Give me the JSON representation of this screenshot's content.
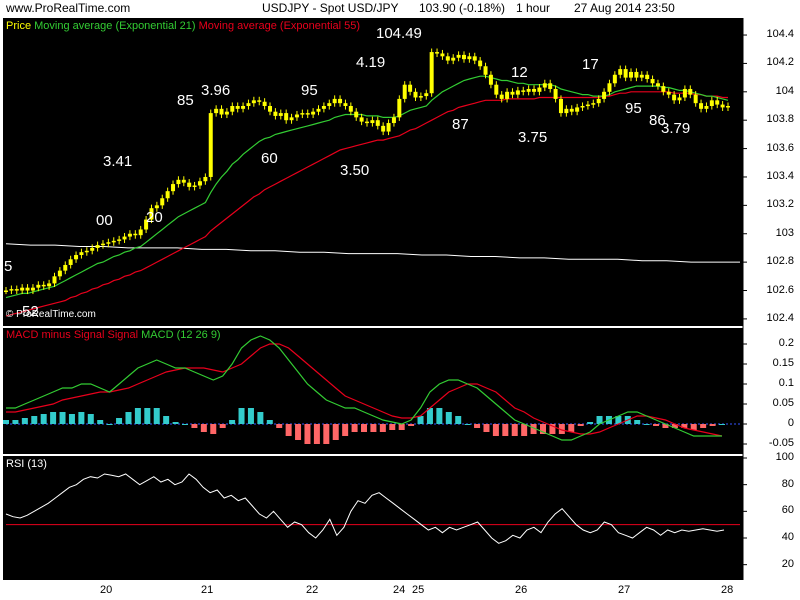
{
  "header": {
    "site": "www.ProRealTime.com",
    "instrument": "USDJPY - Spot USD/JPY",
    "quote": "103.90 (-0.18%)",
    "timeframe": "1 hour",
    "datetime": "27 Aug 2014 23:50"
  },
  "watermark": "© ProRealTime.com",
  "colors": {
    "background": "#000000",
    "candle": "#ffff00",
    "ema21": "#33cc33",
    "ema55": "#e8001c",
    "ma_long": "#ffffff",
    "macd_line": "#33cc33",
    "signal_line": "#e8001c",
    "histogram_pos": "#33cccc",
    "histogram_neg": "#ff6666",
    "rsi_line": "#ffffff",
    "rsi_level": "#e8001c"
  },
  "panels": {
    "price": {
      "legend": [
        {
          "text": "Price",
          "color": "#ffff00"
        },
        {
          "text": "Moving average (Exponential 21)",
          "color": "#33cc33"
        },
        {
          "text": "Moving average (Exponential 55)",
          "color": "#e8001c"
        }
      ],
      "ticks": [
        "104.4",
        "104.2",
        "104",
        "103.8",
        "103.6",
        "103.4",
        "103.2",
        "103",
        "102.8",
        "102.6",
        "102.4"
      ]
    },
    "macd": {
      "legend": [
        {
          "text": "MACD minus Signal",
          "color": "#e8001c"
        },
        {
          "text": "Signal",
          "color": "#e8001c"
        },
        {
          "text": "MACD (12 26 9)",
          "color": "#33cc33"
        }
      ],
      "ticks": [
        "0.2",
        "0.15",
        "0.1",
        "0.05",
        "0",
        "-0.05"
      ]
    },
    "rsi": {
      "legend": [
        {
          "text": "RSI (13)",
          "color": "#ffffff"
        }
      ],
      "ticks": [
        "100",
        "80",
        "60",
        "40",
        "20"
      ]
    }
  },
  "x_ticks": [
    "20",
    "21",
    "22",
    "24",
    "25",
    "26",
    "27",
    "28"
  ],
  "annotations": [
    "5",
    "52",
    "00",
    "20",
    "3.41",
    "85",
    "3.96",
    "60",
    "95",
    "4.19",
    "3.50",
    "104.49",
    "87",
    "12",
    "3.75",
    "17",
    "95",
    "86",
    "3.79"
  ],
  "chart_data": {
    "type": "candlestick",
    "title": "USDJPY - Spot USD/JPY",
    "x_ticks": [
      "20",
      "21",
      "22",
      "24",
      "25",
      "26",
      "27",
      "28"
    ],
    "price_range": [
      102.35,
      104.52
    ],
    "ema21_range_note": "",
    "close": [
      102.6,
      102.61,
      102.6,
      102.62,
      102.6,
      102.62,
      102.64,
      102.63,
      102.65,
      102.7,
      102.74,
      102.78,
      102.82,
      102.85,
      102.87,
      102.88,
      102.9,
      102.92,
      102.93,
      102.94,
      102.95,
      102.96,
      102.98,
      103.0,
      102.99,
      103.03,
      103.1,
      103.18,
      103.2,
      103.25,
      103.3,
      103.35,
      103.38,
      103.36,
      103.33,
      103.34,
      103.37,
      103.4,
      103.85,
      103.88,
      103.84,
      103.86,
      103.9,
      103.88,
      103.9,
      103.92,
      103.94,
      103.93,
      103.9,
      103.86,
      103.83,
      103.85,
      103.8,
      103.82,
      103.84,
      103.85,
      103.84,
      103.86,
      103.88,
      103.9,
      103.92,
      103.95,
      103.92,
      103.9,
      103.86,
      103.82,
      103.79,
      103.78,
      103.8,
      103.76,
      103.72,
      103.78,
      103.82,
      103.95,
      104.05,
      104.0,
      103.96,
      103.97,
      103.99,
      104.28,
      104.27,
      104.25,
      104.22,
      104.24,
      104.26,
      104.23,
      104.25,
      104.22,
      104.18,
      104.12,
      104.05,
      103.98,
      103.95,
      104.0,
      103.98,
      104.01,
      104.0,
      104.02,
      104.0,
      104.03,
      104.06,
      104.02,
      103.95,
      103.85,
      103.88,
      103.86,
      103.89,
      103.9,
      103.91,
      103.92,
      103.95,
      104.0,
      104.06,
      104.12,
      104.16,
      104.1,
      104.14,
      104.1,
      104.12,
      104.09,
      104.06,
      104.04,
      104.0,
      103.98,
      103.94,
      103.96,
      104.02,
      103.98,
      103.92,
      103.88,
      103.9,
      103.94,
      103.91,
      103.89,
      103.9
    ],
    "series": [
      {
        "name": "Moving average (Exponential 21)",
        "values": [
          102.55,
          102.56,
          102.57,
          102.58,
          102.58,
          102.59,
          102.6,
          102.61,
          102.62,
          102.63,
          102.65,
          102.67,
          102.69,
          102.71,
          102.73,
          102.75,
          102.77,
          102.79,
          102.8,
          102.82,
          102.84,
          102.85,
          102.87,
          102.88,
          102.9,
          102.91,
          102.94,
          102.97,
          103.0,
          103.03,
          103.06,
          103.09,
          103.12,
          103.14,
          103.16,
          103.18,
          103.2,
          103.22,
          103.29,
          103.35,
          103.4,
          103.44,
          103.49,
          103.52,
          103.56,
          103.59,
          103.62,
          103.65,
          103.67,
          103.68,
          103.7,
          103.71,
          103.72,
          103.73,
          103.74,
          103.75,
          103.76,
          103.77,
          103.78,
          103.79,
          103.8,
          103.82,
          103.83,
          103.84,
          103.84,
          103.84,
          103.84,
          103.83,
          103.83,
          103.83,
          103.82,
          103.82,
          103.82,
          103.83,
          103.85,
          103.87,
          103.88,
          103.89,
          103.9,
          103.94,
          103.97,
          104.0,
          104.02,
          104.04,
          104.06,
          104.08,
          104.09,
          104.1,
          104.11,
          104.11,
          104.1,
          104.09,
          104.08,
          104.08,
          104.07,
          104.06,
          104.06,
          104.05,
          104.05,
          104.05,
          104.05,
          104.05,
          104.04,
          104.02,
          104.01,
          104.0,
          103.99,
          103.98,
          103.98,
          103.97,
          103.97,
          103.97,
          103.98,
          104.0,
          104.01,
          104.02,
          104.03,
          104.04,
          104.04,
          104.04,
          104.04,
          104.04,
          104.03,
          104.03,
          104.02,
          104.01,
          104.01,
          104.0,
          103.99,
          103.98,
          103.97,
          103.97,
          103.96,
          103.95,
          103.94
        ]
      },
      {
        "name": "Moving average (Exponential 55)",
        "values": [
          102.42,
          102.43,
          102.44,
          102.45,
          102.46,
          102.47,
          102.48,
          102.49,
          102.5,
          102.51,
          102.52,
          102.53,
          102.55,
          102.56,
          102.58,
          102.59,
          102.61,
          102.62,
          102.64,
          102.65,
          102.67,
          102.68,
          102.7,
          102.71,
          102.73,
          102.74,
          102.76,
          102.78,
          102.8,
          102.82,
          102.84,
          102.86,
          102.88,
          102.9,
          102.92,
          102.94,
          102.96,
          102.98,
          103.02,
          103.05,
          103.08,
          103.11,
          103.14,
          103.17,
          103.2,
          103.23,
          103.26,
          103.28,
          103.31,
          103.33,
          103.35,
          103.37,
          103.39,
          103.41,
          103.43,
          103.45,
          103.47,
          103.49,
          103.51,
          103.53,
          103.55,
          103.57,
          103.59,
          103.6,
          103.61,
          103.62,
          103.63,
          103.64,
          103.65,
          103.66,
          103.66,
          103.67,
          103.68,
          103.69,
          103.71,
          103.73,
          103.74,
          103.76,
          103.78,
          103.8,
          103.82,
          103.84,
          103.86,
          103.87,
          103.89,
          103.9,
          103.91,
          103.92,
          103.93,
          103.94,
          103.94,
          103.94,
          103.94,
          103.95,
          103.95,
          103.95,
          103.95,
          103.95,
          103.95,
          103.96,
          103.96,
          103.96,
          103.96,
          103.96,
          103.96,
          103.96,
          103.96,
          103.96,
          103.96,
          103.96,
          103.96,
          103.97,
          103.97,
          103.98,
          103.99,
          103.99,
          104.0,
          104.0,
          104.0,
          104.0,
          104.0,
          104.0,
          104.0,
          104.0,
          103.99,
          103.99,
          103.99,
          103.99,
          103.98,
          103.98,
          103.97,
          103.97,
          103.97,
          103.96,
          103.96
        ]
      },
      {
        "name": "long_ma",
        "values": [
          102.93,
          102.92,
          102.92,
          102.91,
          102.91,
          102.9,
          102.9,
          102.9,
          102.89,
          102.89,
          102.88,
          102.88,
          102.87,
          102.87,
          102.86,
          102.86,
          102.86,
          102.85,
          102.85,
          102.84,
          102.84,
          102.83,
          102.83,
          102.82,
          102.82,
          102.82,
          102.81,
          102.81,
          102.8,
          102.8,
          102.8
        ]
      }
    ],
    "macd": {
      "range": [
        -0.07,
        0.235
      ],
      "macd": [
        0.04,
        0.04,
        0.05,
        0.06,
        0.07,
        0.08,
        0.09,
        0.09,
        0.1,
        0.1,
        0.09,
        0.08,
        0.1,
        0.12,
        0.14,
        0.15,
        0.16,
        0.15,
        0.14,
        0.14,
        0.13,
        0.12,
        0.11,
        0.12,
        0.15,
        0.19,
        0.21,
        0.22,
        0.21,
        0.19,
        0.16,
        0.13,
        0.1,
        0.08,
        0.06,
        0.05,
        0.04,
        0.04,
        0.03,
        0.02,
        0.01,
        0.005,
        0.0,
        0.01,
        0.04,
        0.08,
        0.1,
        0.11,
        0.11,
        0.1,
        0.09,
        0.07,
        0.05,
        0.03,
        0.01,
        0.0,
        -0.01,
        -0.02,
        -0.03,
        -0.04,
        -0.04,
        -0.03,
        -0.02,
        0.0,
        0.01,
        0.02,
        0.03,
        0.03,
        0.02,
        0.01,
        0.0,
        -0.01,
        -0.02,
        -0.03,
        -0.03,
        -0.03,
        -0.03
      ],
      "signal": [
        0.03,
        0.03,
        0.035,
        0.04,
        0.045,
        0.05,
        0.06,
        0.065,
        0.07,
        0.075,
        0.08,
        0.08,
        0.085,
        0.09,
        0.1,
        0.11,
        0.12,
        0.13,
        0.135,
        0.14,
        0.14,
        0.14,
        0.135,
        0.13,
        0.14,
        0.15,
        0.17,
        0.19,
        0.2,
        0.2,
        0.19,
        0.17,
        0.15,
        0.13,
        0.11,
        0.09,
        0.07,
        0.06,
        0.05,
        0.04,
        0.03,
        0.02,
        0.015,
        0.015,
        0.02,
        0.04,
        0.06,
        0.08,
        0.09,
        0.1,
        0.1,
        0.09,
        0.08,
        0.06,
        0.04,
        0.03,
        0.015,
        0.005,
        -0.005,
        -0.015,
        -0.02,
        -0.025,
        -0.025,
        -0.02,
        -0.01,
        0.0,
        0.01,
        0.02,
        0.02,
        0.015,
        0.01,
        0.0,
        -0.01,
        -0.015,
        -0.02,
        -0.025,
        -0.03
      ],
      "histogram": [
        0.01,
        0.01,
        0.015,
        0.02,
        0.025,
        0.03,
        0.03,
        0.025,
        0.03,
        0.025,
        0.01,
        0.0,
        0.015,
        0.03,
        0.04,
        0.04,
        0.04,
        0.02,
        0.005,
        0.0,
        -0.01,
        -0.02,
        -0.025,
        -0.01,
        0.01,
        0.04,
        0.04,
        0.03,
        0.01,
        -0.01,
        -0.03,
        -0.04,
        -0.05,
        -0.05,
        -0.05,
        -0.04,
        -0.03,
        -0.02,
        -0.02,
        -0.02,
        -0.02,
        -0.015,
        -0.015,
        -0.005,
        0.02,
        0.04,
        0.04,
        0.03,
        0.02,
        0.0,
        -0.01,
        -0.02,
        -0.03,
        -0.03,
        -0.03,
        -0.03,
        -0.025,
        -0.025,
        -0.025,
        -0.025,
        -0.02,
        -0.005,
        0.005,
        0.02,
        0.02,
        0.02,
        0.02,
        0.01,
        0.0,
        -0.005,
        -0.01,
        -0.01,
        -0.01,
        -0.015,
        -0.01,
        -0.005,
        0.0
      ]
    },
    "rsi": {
      "range": [
        10,
        100
      ],
      "level": 50,
      "values": [
        58,
        56,
        55,
        57,
        60,
        63,
        66,
        70,
        74,
        78,
        80,
        84,
        86,
        85,
        88,
        87,
        86,
        88,
        84,
        80,
        83,
        86,
        82,
        84,
        80,
        82,
        88,
        84,
        78,
        74,
        76,
        70,
        72,
        68,
        70,
        64,
        58,
        55,
        60,
        54,
        48,
        52,
        50,
        44,
        40,
        46,
        54,
        42,
        48,
        60,
        68,
        66,
        72,
        74,
        70,
        66,
        62,
        58,
        54,
        50,
        46,
        48,
        44,
        48,
        46,
        48,
        50,
        52,
        46,
        40,
        36,
        38,
        42,
        40,
        46,
        48,
        44,
        52,
        58,
        62,
        56,
        50,
        46,
        44,
        46,
        52,
        50,
        44,
        42,
        40,
        44,
        48,
        46,
        42,
        46,
        44,
        46,
        45,
        46,
        47,
        46,
        45,
        46
      ]
    }
  }
}
